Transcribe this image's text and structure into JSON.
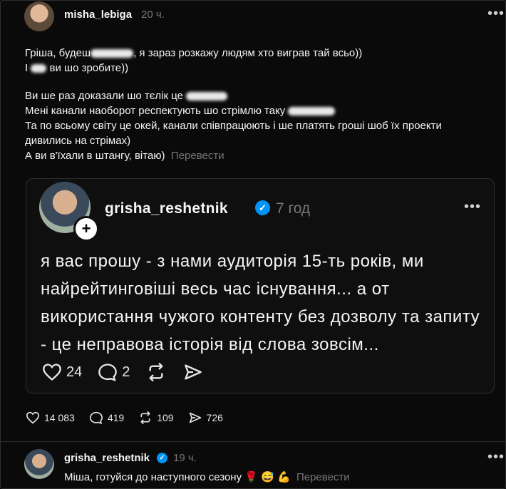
{
  "post": {
    "username": "misha_lebiga",
    "time": "20 ч.",
    "lines": {
      "l1a": "Гріша, будеш",
      "l1b": ", я зараз розкажу людям хто виграв тай всьо))",
      "l2a": "І",
      "l2b": "ви шо зробите))",
      "l3a": "Ви ше раз доказали шо тєлік це",
      "l4a": "Мені канали наоборот респектують шо стрімлю таку",
      "l5": "Та по всьому світу це окей, канали співпрацюють і ше платять гроші шоб їх проекти",
      "l6": "дивились на стрімах)",
      "l7": "А ви в'їхали в штангу, вітаю)"
    },
    "translate": "Перевести",
    "stats": {
      "likes": "14 083",
      "comments": "419",
      "reposts": "109",
      "shares": "726"
    }
  },
  "quoted": {
    "username": "grisha_reshetnik",
    "time": "7 год",
    "text": "я вас прошу - з нами аудиторія 15-ть років, ми найрейтинговіші весь час існування... а от використання чужого контенту без дозволу та запиту - це неправова історія від слова зовсім...",
    "likes": "24",
    "comments": "2"
  },
  "reply": {
    "username": "grisha_reshetnik",
    "time": "19 ч.",
    "text": "Міша, готуйся до наступного сезону",
    "emoji": "🌹 😅 💪",
    "translate": "Перевести"
  },
  "colors": {
    "verified": "#0095f6",
    "muted": "#777777",
    "background": "#0a0a0a"
  }
}
